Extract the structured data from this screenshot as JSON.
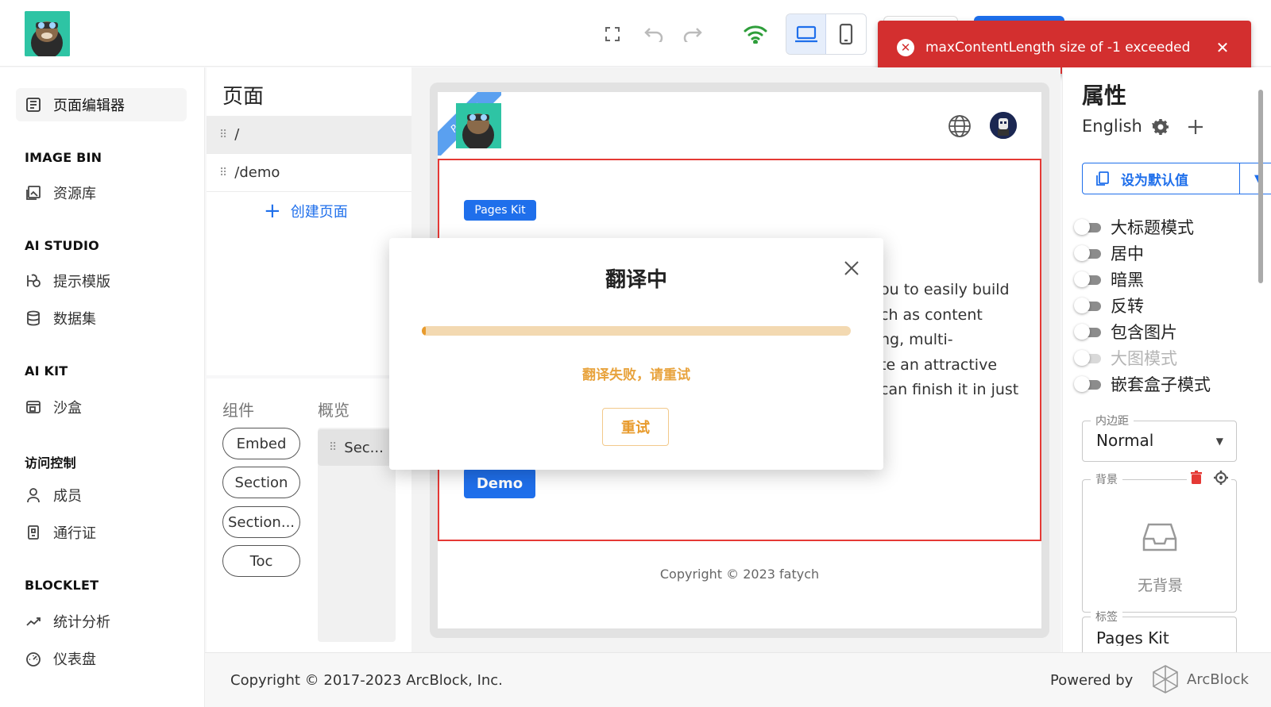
{
  "toast": {
    "message": "maxContentLength size of -1 exceeded"
  },
  "sidebar": {
    "items": [
      {
        "label": "页面编辑器"
      },
      {
        "label": "资源库"
      },
      {
        "label": "提示模版"
      },
      {
        "label": "数据集"
      },
      {
        "label": "沙盒"
      },
      {
        "label": "成员"
      },
      {
        "label": "通行证"
      },
      {
        "label": "统计分析"
      },
      {
        "label": "仪表盘"
      }
    ],
    "sections": [
      "IMAGE BIN",
      "AI STUDIO",
      "AI KIT",
      "访问控制",
      "BLOCKLET"
    ]
  },
  "pages": {
    "title": "页面",
    "rows": [
      "/",
      "/demo"
    ],
    "create_label": "创建页面"
  },
  "components": {
    "tab_components": "组件",
    "tab_overview": "概览",
    "chips": [
      "Embed",
      "Section",
      "Section...",
      "Toc"
    ],
    "overview_item": "Sec..."
  },
  "preview": {
    "ribbon": "Preview",
    "chip": "Pages Kit",
    "text_lines": [
      "ou to easily build",
      "ch as content",
      "ng, multi-",
      "te an attractive",
      "can finish it in just"
    ],
    "demo_button": "Demo",
    "copyright": "Copyright © 2023 fatych"
  },
  "modal": {
    "title": "翻译中",
    "progress": 0.01,
    "error": "翻译失败，请重试",
    "retry": "重试"
  },
  "props": {
    "title": "属性",
    "language": "English",
    "default_button": "设为默认值",
    "toggles": [
      "大标题模式",
      "居中",
      "暗黑",
      "反转",
      "包含图片",
      "大图模式",
      "嵌套盒子模式"
    ],
    "padding_legend": "内边距",
    "padding_value": "Normal",
    "background_legend": "背景",
    "no_background": "无背景",
    "tag_legend": "标签",
    "tag_value": "Pages Kit"
  },
  "footer": {
    "copyright": "Copyright © 2017-2023  ArcBlock, Inc.",
    "powered_by": "Powered by",
    "brand": "ArcBlock"
  },
  "colors": {
    "primary": "#1f6feb",
    "error": "#d32f2f",
    "warning": "#e89b2d"
  }
}
